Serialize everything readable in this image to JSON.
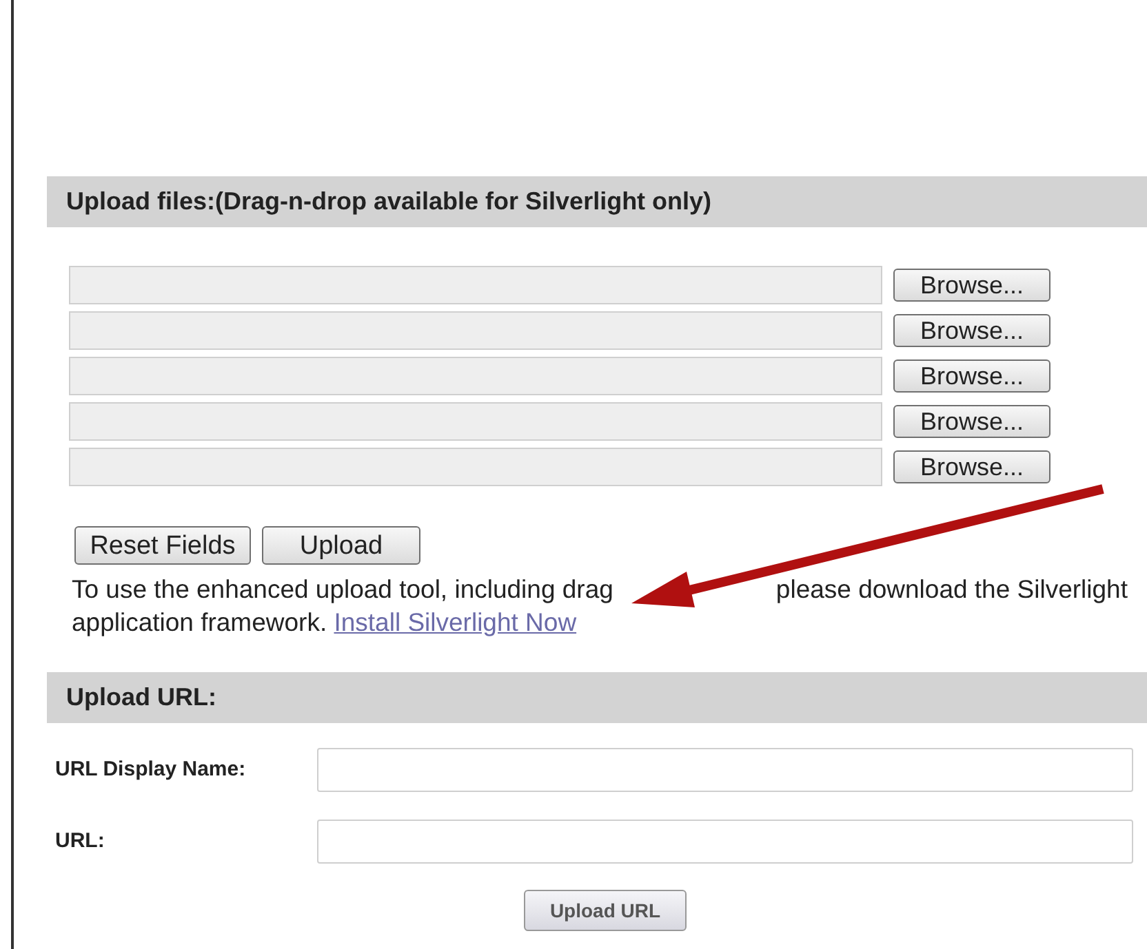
{
  "upload_files": {
    "heading": "Upload files:(Drag-n-drop available for Silverlight only)",
    "file_rows": [
      {
        "button": "Browse..."
      },
      {
        "button": "Browse..."
      },
      {
        "button": "Browse..."
      },
      {
        "button": "Browse..."
      },
      {
        "button": "Browse..."
      }
    ],
    "buttons": [
      "Reset Fields",
      "Upload"
    ],
    "notice": [
      "To use the enhanced upload tool, including drag",
      "please download the Silverlight",
      "application framework."
    ],
    "link": "Install Silverlight Now"
  },
  "upload_url": {
    "heading": "Upload URL:",
    "fields": [
      {
        "label": "URL Display Name:"
      },
      {
        "label": "URL:"
      }
    ],
    "button": "Upload URL"
  }
}
